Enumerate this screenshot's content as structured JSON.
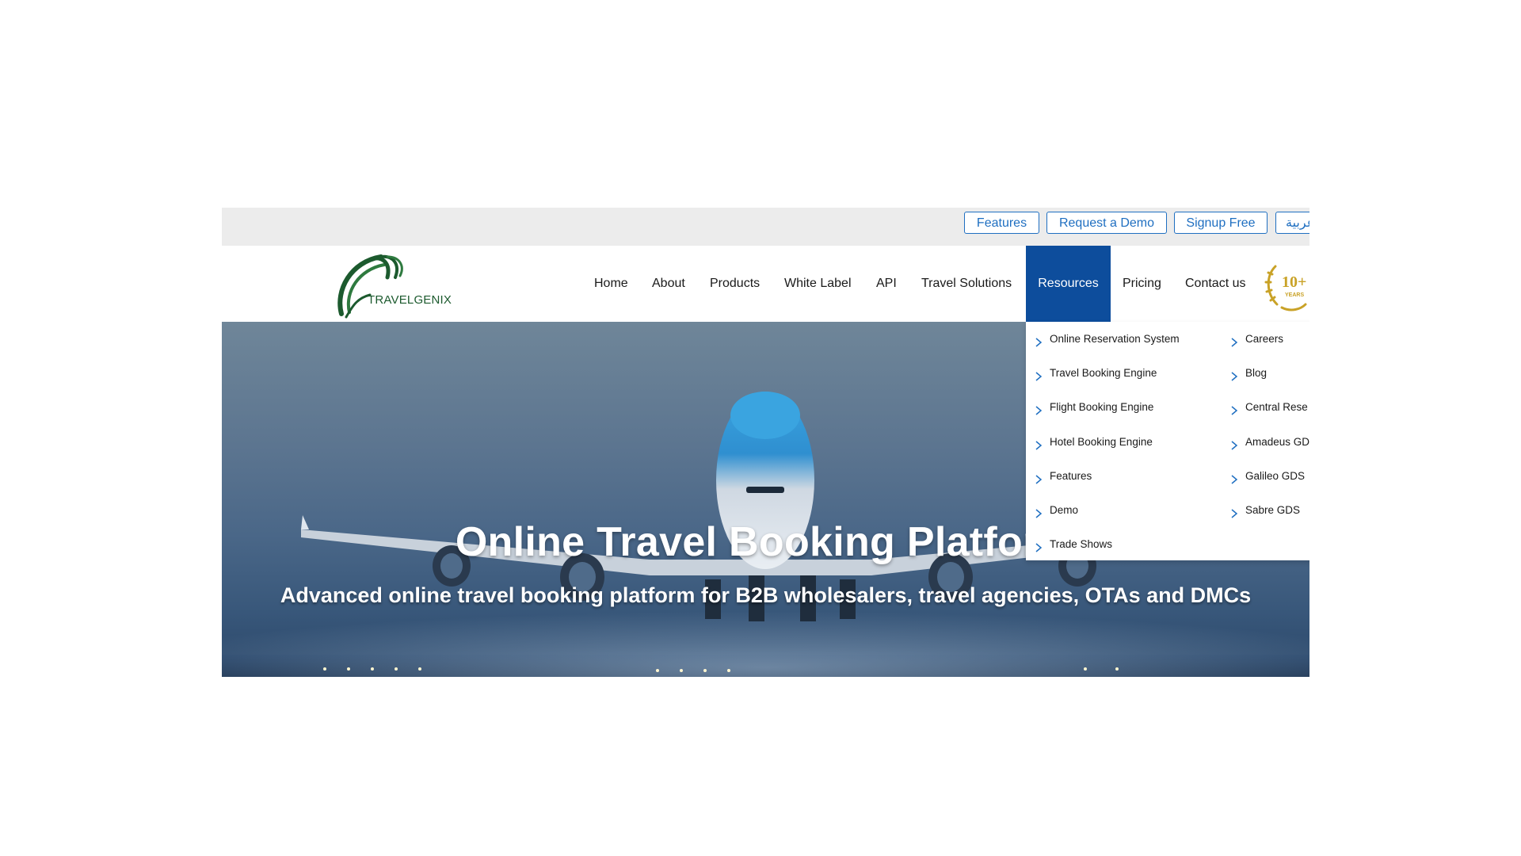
{
  "topbar": {
    "features_label": "Features",
    "demo_label": "Request a Demo",
    "signup_label": "Signup Free",
    "language_label": "عربية"
  },
  "header": {
    "logo_text": "TRAVELGENIX",
    "badge_text": "10+",
    "badge_sub": "YEARS",
    "nav": [
      "Home",
      "About",
      "Products",
      "White Label",
      "API",
      "Travel Solutions",
      "Resources",
      "Pricing",
      "Contact us"
    ],
    "active_nav": "Resources"
  },
  "dropdown": {
    "left_column": [
      "Online Reservation System",
      "Travel Booking Engine",
      "Flight Booking Engine",
      "Hotel Booking Engine",
      "Features",
      "Demo",
      "Trade Shows"
    ],
    "right_column": [
      "Careers",
      "Blog",
      "Central Rese",
      "Amadeus GD",
      "Galileo GDS",
      "Sabre GDS"
    ]
  },
  "hero": {
    "title": "Online Travel Booking Platform",
    "subtitle": "Advanced online travel booking platform for B2B wholesalers, travel agencies, OTAs and DMCs"
  },
  "colors": {
    "accent": "#1f6fc1",
    "active_nav_bg": "#0d4d9c",
    "logo_green": "#1c5a2e",
    "badge_gold": "#c9a227"
  }
}
